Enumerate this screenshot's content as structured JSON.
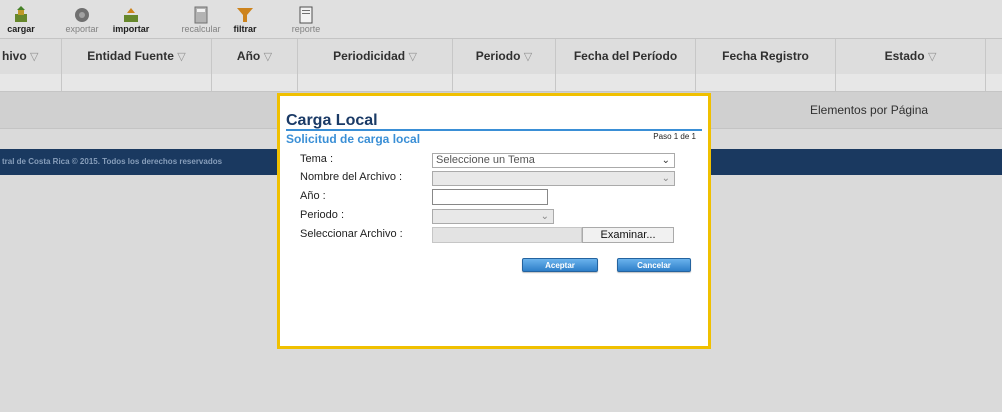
{
  "toolbar": {
    "cargar": "cargar",
    "exportar": "exportar",
    "importar": "importar",
    "recalcular": "recalcular",
    "filtrar": "filtrar",
    "reporte": "reporte"
  },
  "grid": {
    "columns": [
      "hivo",
      "Entidad Fuente",
      "Año",
      "Periodicidad",
      "Periodo",
      "Fecha del Período",
      "Fecha Registro",
      "Estado"
    ],
    "pager_label": "Elementos por Página"
  },
  "footer": {
    "text": "tral de Costa Rica © 2015. Todos los derechos reservados"
  },
  "modal": {
    "title": "Carga Local",
    "subtitle": "Solicitud de carga local",
    "step": "Paso 1 de 1",
    "fields": {
      "tema_label": "Tema :",
      "tema_value": "Seleccione un Tema",
      "archivo_label": "Nombre del Archivo :",
      "anio_label": "Año :",
      "periodo_label": "Periodo :",
      "seleccionar_label": "Seleccionar Archivo :",
      "examinar": "Examinar..."
    },
    "accept": "Aceptar",
    "cancel": "Cancelar"
  },
  "colors": {
    "modal_border": "#f0c000",
    "title": "#1a3a66",
    "accent": "#3a8fd6",
    "footer": "#1c3d66"
  }
}
